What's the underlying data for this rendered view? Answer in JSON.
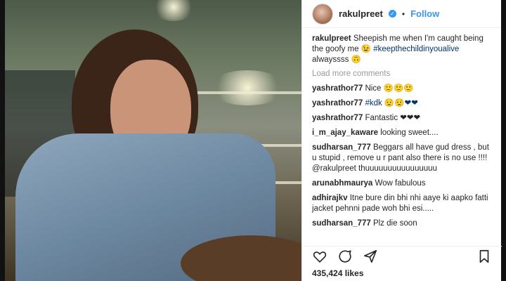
{
  "post": {
    "username": "rakulpreet",
    "follow_label": "Follow",
    "separator": "•",
    "verified_mark": "✓"
  },
  "caption": {
    "username": "rakulpreet",
    "text": "Sheepish me when I'm caught being the goofy me 😉",
    "hashtag": "#keepthechildinyoualive",
    "tail": "alwayssss 🙃"
  },
  "load_more_label": "Load more comments",
  "comments": [
    {
      "user": "yashrathor77",
      "text": "Nice 🙂🙂🙂"
    },
    {
      "user": "yashrathor77",
      "text": "#kdk 😟😟❤❤"
    },
    {
      "user": "yashrathor77",
      "text": "Fantastic ❤❤❤"
    },
    {
      "user": "i_m_ajay_kaware",
      "text": "looking sweet...."
    },
    {
      "user": "sudharsan_777",
      "text": "Beggars all have gud dress , but u stupid , remove u r pant also there is no use !!!! @rakulpreet thuuuuuuuuuuuuuuuu"
    },
    {
      "user": "arunabhmaurya",
      "text": "Wow fabulous"
    },
    {
      "user": "adhirajkv",
      "text": "Itne bure din bhi nhi aaye ki aapko fatti jacket pehnni pade woh bhi esi....."
    },
    {
      "user": "sudharsan_777",
      "text": "Plz die soon"
    }
  ],
  "likes": "435,424 likes",
  "icons": {
    "like": "heart-icon",
    "comment": "comment-icon",
    "share": "share-icon",
    "save": "bookmark-icon"
  },
  "colors": {
    "link": "#3897f0",
    "text": "#262626",
    "muted": "#999999"
  }
}
